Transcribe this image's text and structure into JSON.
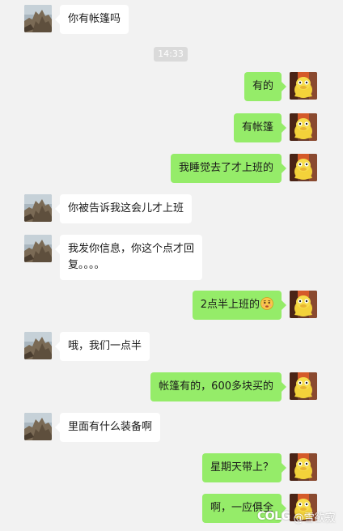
{
  "chat": {
    "timestamp": "14:33",
    "messages": [
      {
        "side": "in",
        "text": "你有帐篷吗"
      },
      {
        "side": "out",
        "text": "有的"
      },
      {
        "side": "out",
        "text": "有帐篷"
      },
      {
        "side": "out",
        "text": "我睡觉去了才上班的"
      },
      {
        "side": "in",
        "text": "你被告诉我这会儿才上班"
      },
      {
        "side": "in",
        "text_line1": "我发你信息，你这个点才回",
        "text_line2": "复。。。。"
      },
      {
        "side": "out",
        "text": "2点半上班的",
        "emoji": "worried-face-emoji"
      },
      {
        "side": "in",
        "text": "哦，我们一点半"
      },
      {
        "side": "out",
        "text": "帐篷有的，600多块买的"
      },
      {
        "side": "in",
        "text": "里面有什么装备啊"
      },
      {
        "side": "out",
        "text": "星期天带上？"
      },
      {
        "side": "out",
        "text": "啊，一应俱全"
      }
    ]
  },
  "watermark": {
    "logo": "COLG",
    "handle": "@雪欲寂"
  },
  "colors": {
    "background": "#f2f2f2",
    "incoming_bubble": "#ffffff",
    "outgoing_bubble": "#95ec69",
    "timestamp_bg": "#dadada"
  },
  "icons": {
    "incoming_avatar": "mountain-avatar-icon",
    "outgoing_avatar": "cartoon-duck-avatar-icon"
  }
}
